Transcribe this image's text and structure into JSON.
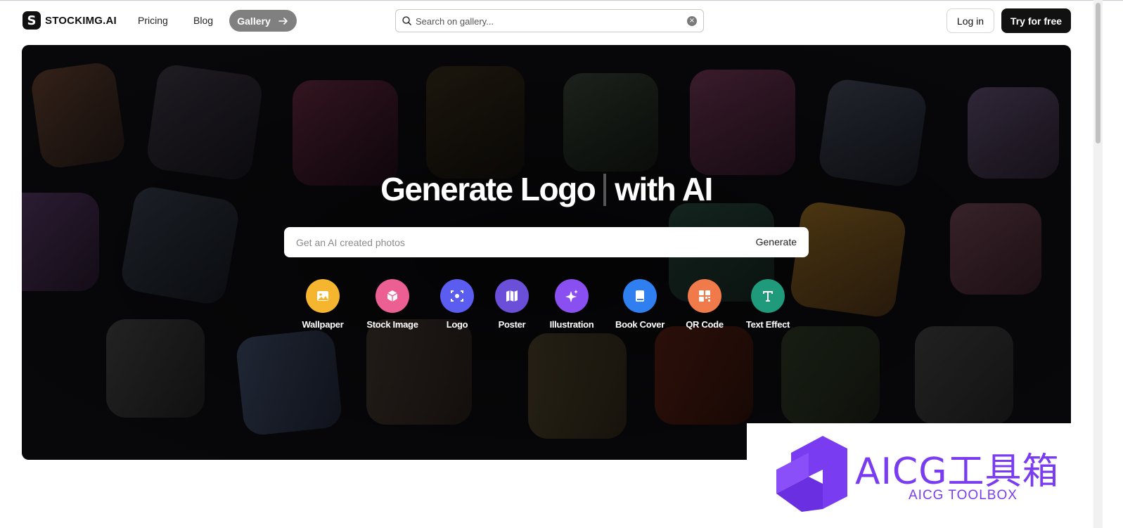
{
  "header": {
    "brand_mark": "S",
    "brand_name": "STOCKIMG.AI",
    "nav": {
      "pricing": "Pricing",
      "blog": "Blog",
      "gallery": "Gallery"
    },
    "search": {
      "placeholder": "Search on gallery..."
    },
    "login_label": "Log in",
    "try_label": "Try for free"
  },
  "hero": {
    "title_part1": "Generate Logo",
    "title_part2": "with AI",
    "input_placeholder": "Get an AI created photos",
    "generate_label": "Generate",
    "categories": [
      {
        "label": "Wallpaper",
        "icon": "image-icon",
        "color": "#f5b52e"
      },
      {
        "label": "Stock Image",
        "icon": "box-icon",
        "color": "#ec5f93"
      },
      {
        "label": "Logo",
        "icon": "focus-icon",
        "color": "#5b5cf0"
      },
      {
        "label": "Poster",
        "icon": "map-icon",
        "color": "#6b4fd8"
      },
      {
        "label": "Illustration",
        "icon": "sparkle-icon",
        "color": "#8a4ff0"
      },
      {
        "label": "Book Cover",
        "icon": "book-icon",
        "color": "#2f7ff0"
      },
      {
        "label": "QR Code",
        "icon": "qr-icon",
        "color": "#f07a4a"
      },
      {
        "label": "Text Effect",
        "icon": "text-icon",
        "color": "#1f9a7a"
      }
    ]
  },
  "watermark": {
    "title": "AICG工具箱",
    "subtitle": "AICG TOOLBOX",
    "color": "#7a3cf0"
  }
}
